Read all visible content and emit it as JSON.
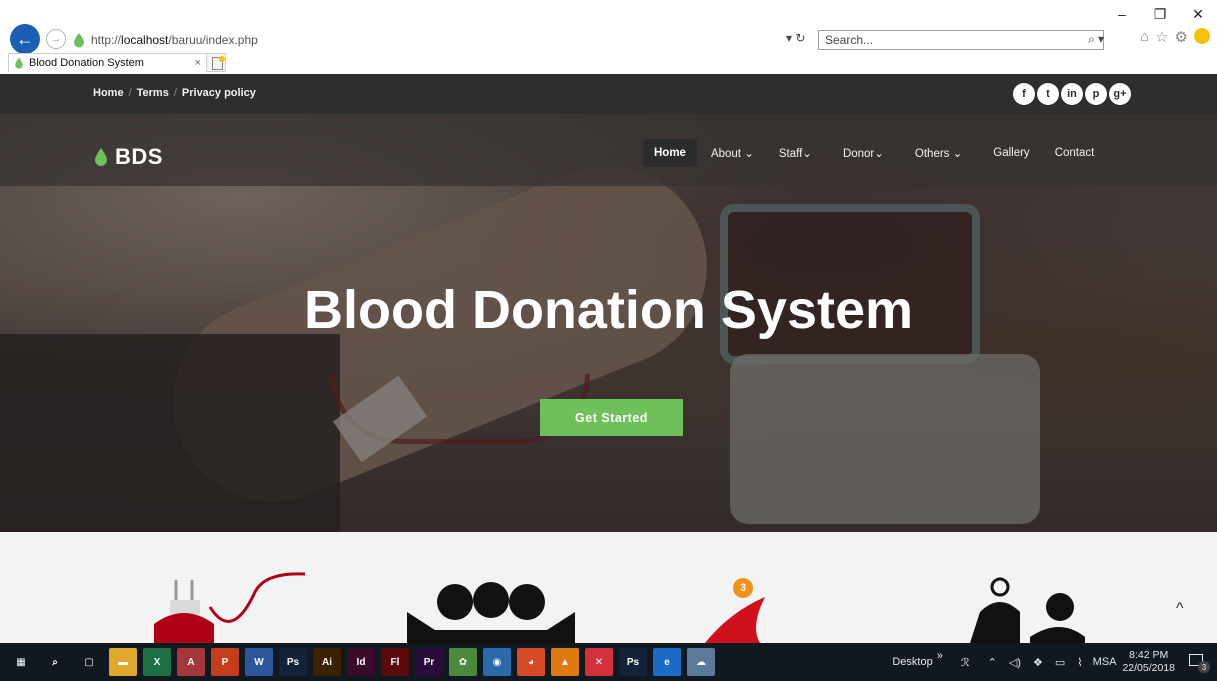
{
  "browser": {
    "url_prefix": "http://",
    "url_host": "localhost",
    "url_path": "/baruu/index.php",
    "refresh_glyph": "▾ ↻",
    "search_placeholder": "Search...",
    "search_glyph": "⌕ ▾",
    "tab_title": "Blood Donation System",
    "tab_close": "×",
    "window_controls": [
      "–",
      "❐",
      "✕"
    ],
    "toolbar_icons": [
      "home-icon",
      "favorites-star-icon",
      "settings-gear-icon",
      "feedback-smiley-icon"
    ]
  },
  "topbar": {
    "links": [
      "Home",
      "Terms",
      "Privacy policy"
    ],
    "separator": "/",
    "social": [
      "f",
      "t",
      "in",
      "p",
      "g+"
    ]
  },
  "navbar": {
    "brand": "BDS",
    "items": [
      {
        "label": "Home"
      },
      {
        "label": "About ⌄"
      },
      {
        "label": "Staff⌄"
      },
      {
        "label": "Donor⌄"
      },
      {
        "label": "Others ⌄"
      },
      {
        "label": "Gallery"
      },
      {
        "label": "Contact"
      }
    ]
  },
  "hero": {
    "title": "Blood Donation System",
    "cta": "Get Started"
  },
  "features": {
    "badge": "3",
    "to_top": "^"
  },
  "taskbar": {
    "apps": [
      {
        "name": "start-icon",
        "text": "▦",
        "color": "#101820"
      },
      {
        "name": "search-icon",
        "text": "⌕",
        "color": "#101820"
      },
      {
        "name": "task-view-icon",
        "text": "▢",
        "color": "#101820"
      },
      {
        "name": "file-explorer-icon",
        "text": "▬",
        "color": "#e0a92b"
      },
      {
        "name": "excel-icon",
        "text": "X",
        "color": "#1d7044"
      },
      {
        "name": "access-icon",
        "text": "A",
        "color": "#a4373a"
      },
      {
        "name": "powerpoint-icon",
        "text": "P",
        "color": "#c43e1c"
      },
      {
        "name": "word-icon",
        "text": "W",
        "color": "#2b579a"
      },
      {
        "name": "photoshop-icon",
        "text": "Ps",
        "color": "#12223a"
      },
      {
        "name": "illustrator-icon",
        "text": "Ai",
        "color": "#3a2200"
      },
      {
        "name": "indesign-icon",
        "text": "Id",
        "color": "#3a0a2a"
      },
      {
        "name": "flash-icon",
        "text": "Fl",
        "color": "#5a0a0a"
      },
      {
        "name": "premiere-icon",
        "text": "Pr",
        "color": "#2a0a3a"
      },
      {
        "name": "paint-icon",
        "text": "✿",
        "color": "#4a8a3a"
      },
      {
        "name": "network-app-icon",
        "text": "◉",
        "color": "#2a6aa8"
      },
      {
        "name": "chrome-icon",
        "text": "◕",
        "color": "#d64a2a"
      },
      {
        "name": "vlc-icon",
        "text": "▲",
        "color": "#e07a10"
      },
      {
        "name": "xampp-icon",
        "text": "✕",
        "color": "#d2303a"
      },
      {
        "name": "photoshop2-icon",
        "text": "Ps",
        "color": "#12223a"
      },
      {
        "name": "internet-explorer-icon",
        "text": "e",
        "color": "#1a6ac8"
      },
      {
        "name": "network-icon",
        "text": "☁",
        "color": "#5a7a9a"
      }
    ],
    "desktop_label": "Desktop",
    "desktop_chevron": "»",
    "tray_icons": [
      "people-icon",
      "up-arrow-icon",
      "volume-icon",
      "dropbox-icon",
      "battery-icon",
      "wifi-icon"
    ],
    "language": "MSA",
    "time": "8:42 PM",
    "date": "22/05/2018",
    "notifications": "3"
  }
}
